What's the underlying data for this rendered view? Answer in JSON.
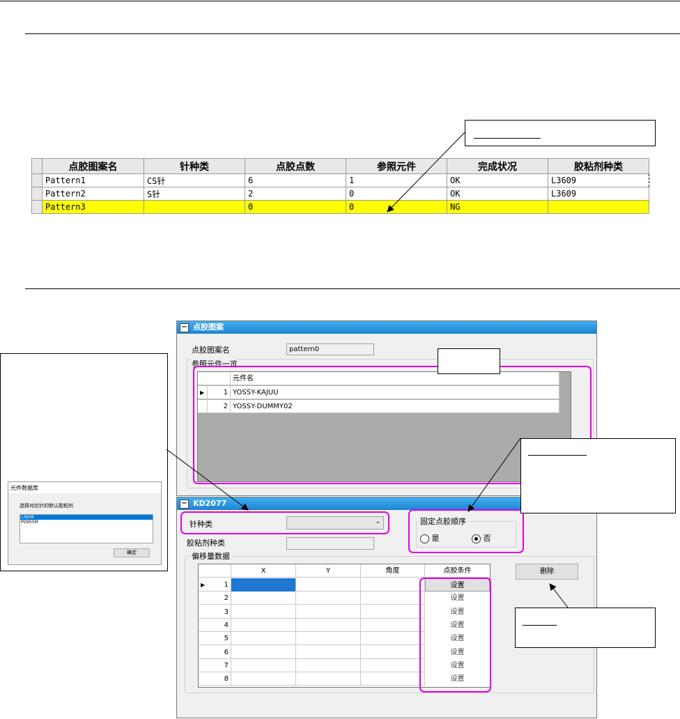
{
  "top_table": {
    "headers": [
      "点胶图案名",
      "针种类",
      "点胶点数",
      "参照元件",
      "完成状况",
      "胶粘剂种类"
    ],
    "rows": [
      [
        "Pattern1",
        "CS针",
        "6",
        "1",
        "OK",
        "L3609"
      ],
      [
        "Pattern2",
        "S针",
        "2",
        "0",
        "OK",
        "L3609"
      ],
      [
        "Pattern3",
        "",
        "0",
        "0",
        "NG",
        ""
      ]
    ]
  },
  "pattern_window": {
    "title": "点胶图案",
    "name_label": "点胶图案名",
    "name_value": "pattern0",
    "ref_list_label": "参照元件一览",
    "ref_grid_header": "元件名",
    "ref_rows": [
      {
        "no": "1",
        "name": "YOSSY-KAJUU"
      },
      {
        "no": "2",
        "name": "YOSSY-DUMMY02"
      }
    ]
  },
  "kd_window": {
    "title": "KD2077",
    "needle_label": "针种类",
    "needle_value": "",
    "fixed_order_label": "固定点胶顺序",
    "yes_label": "是",
    "no_label": "否",
    "adhesive_label": "胶粘剂种类",
    "adhesive_value": "",
    "offset_label": "偏移量数据",
    "delete_label": "删除",
    "grid_headers": [
      "X",
      "Y",
      "角度",
      "点胶条件"
    ],
    "rows": [
      "1",
      "2",
      "3",
      "4",
      "5",
      "6",
      "7",
      "8"
    ],
    "set_label": "设置"
  },
  "dialog": {
    "title": "元件数据库",
    "prompt": "选择对应针的默认胶粘剂",
    "options": [
      "L3609",
      "PD955M"
    ],
    "ok_label": "确定"
  },
  "colors": {
    "highlight": "#e000e0",
    "ng_row": "#ffff00",
    "titlebar": "#1c84d0"
  }
}
